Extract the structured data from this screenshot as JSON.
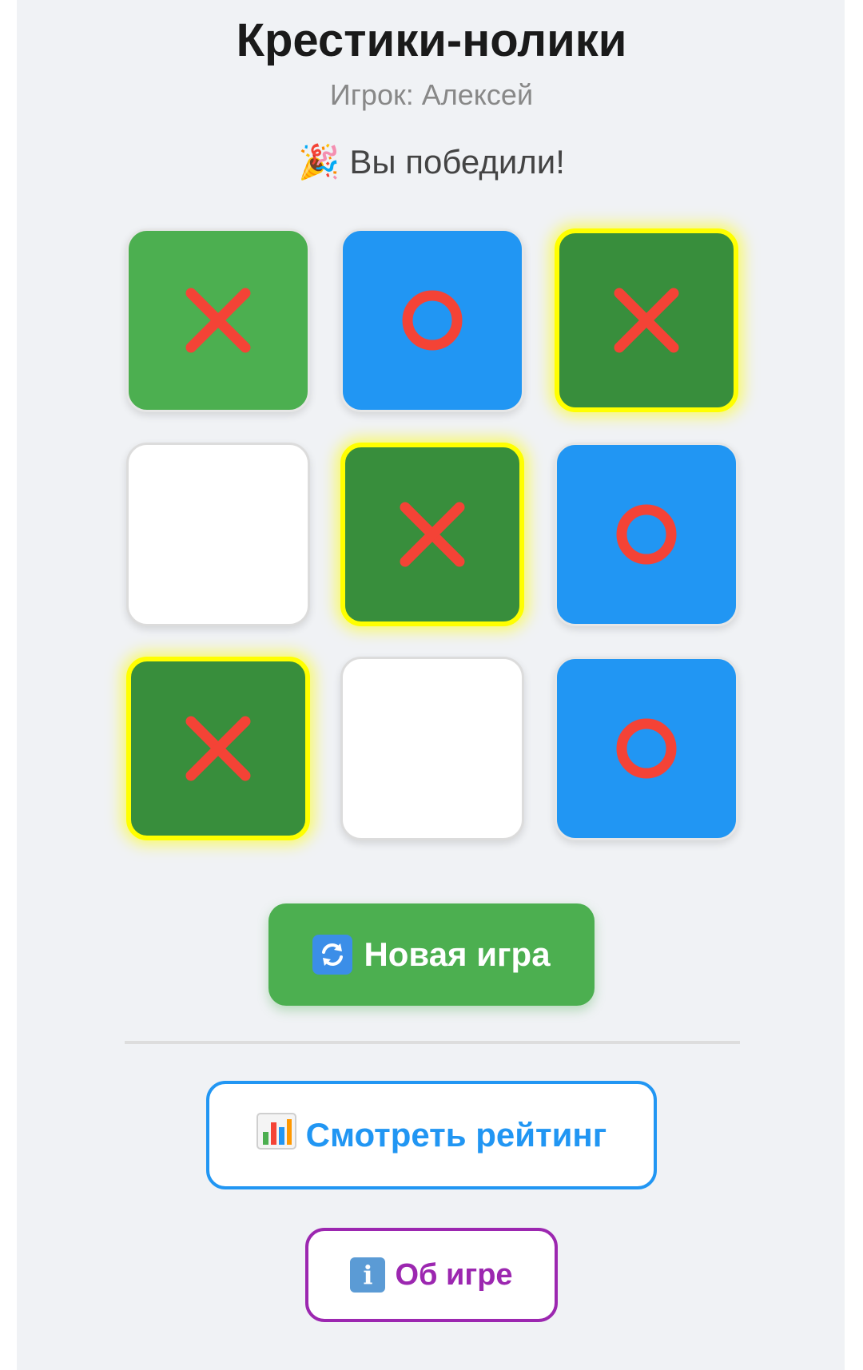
{
  "game": {
    "title": "Крестики-нолики",
    "player_label": "Игрок: Алексей",
    "status_emoji": "🎉",
    "status_text": "Вы победили!"
  },
  "board": {
    "cells": [
      "X",
      "O",
      "X",
      "",
      "X",
      "O",
      "X",
      "",
      "O"
    ],
    "winning_line": [
      2,
      4,
      6
    ]
  },
  "buttons": {
    "new_game_label": "Новая игра",
    "new_game_icon": "refresh-icon",
    "rating_label": "Смотреть рейтинг",
    "rating_icon": "bar-chart-icon",
    "about_label": "Об игре",
    "about_icon": "info-icon"
  },
  "colors": {
    "x_cell": "#4caf50",
    "x_win_cell": "#388e3c",
    "o_cell": "#2196f3",
    "win_border": "#ffff00",
    "mark_red": "#f44336",
    "rating_accent": "#2196f3",
    "about_accent": "#9c27b0"
  }
}
